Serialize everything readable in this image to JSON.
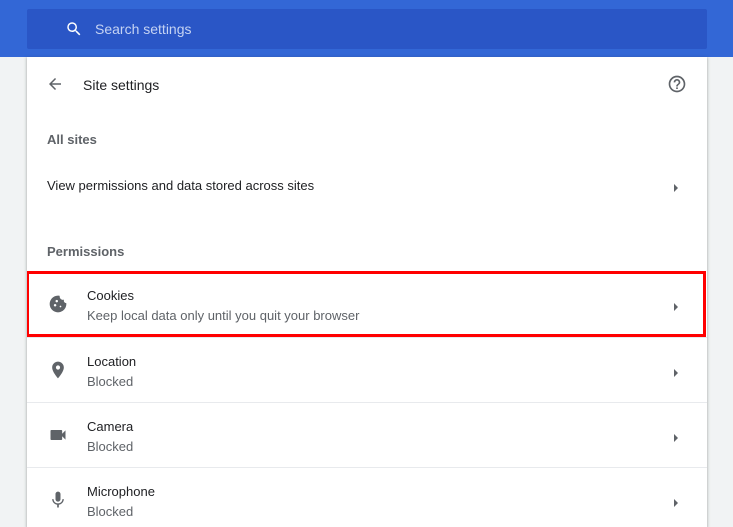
{
  "search": {
    "placeholder": "Search settings",
    "icon": "search-icon"
  },
  "header": {
    "back_icon": "arrow-back-icon",
    "title": "Site settings",
    "help_icon": "help-circle-icon"
  },
  "all_sites": {
    "section_title": "All sites",
    "row_label": "View permissions and data stored across sites"
  },
  "permissions": {
    "section_title": "Permissions",
    "items": [
      {
        "title": "Cookies",
        "subtitle": "Keep local data only until you quit your browser",
        "icon": "cookie-icon",
        "highlighted": true
      },
      {
        "title": "Location",
        "subtitle": "Blocked",
        "icon": "location-pin-icon"
      },
      {
        "title": "Camera",
        "subtitle": "Blocked",
        "icon": "camera-icon"
      },
      {
        "title": "Microphone",
        "subtitle": "Blocked",
        "icon": "microphone-icon"
      }
    ]
  },
  "colors": {
    "topbar": "#3367d6",
    "search_bg": "#2a56c6",
    "highlight": "#ff0000"
  }
}
